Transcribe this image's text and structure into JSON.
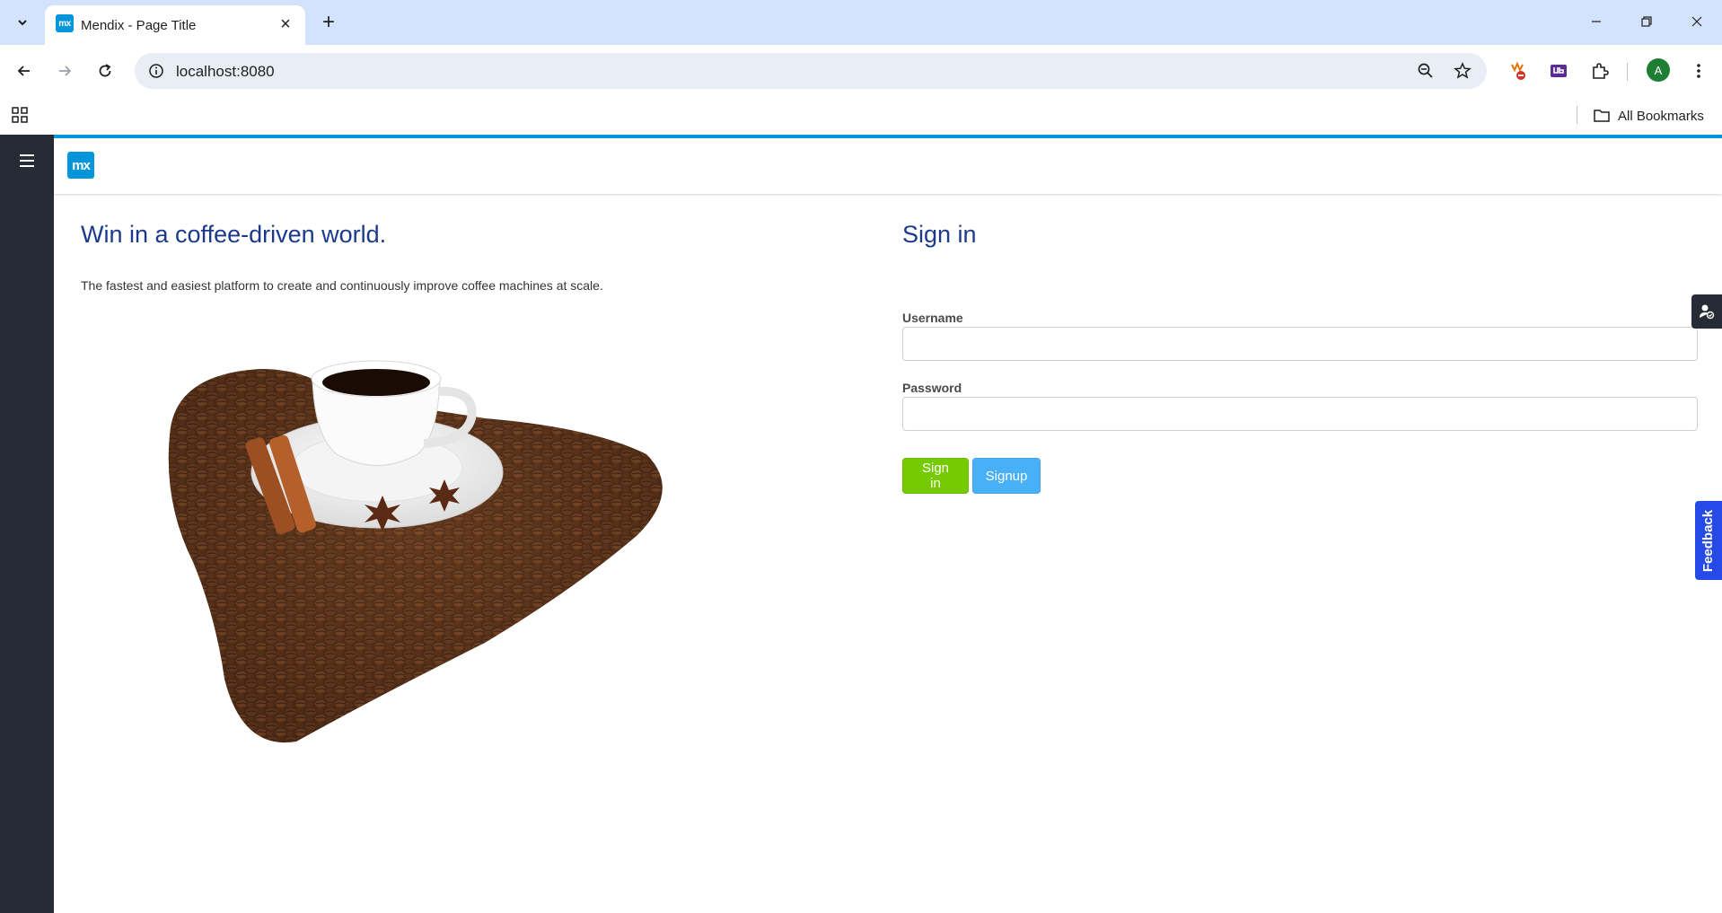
{
  "browser": {
    "tab_title": "Mendix - Page Title",
    "favicon_text": "mx",
    "url": "localhost:8080",
    "avatar_letter": "A",
    "bookmarks_label": "All Bookmarks"
  },
  "app": {
    "logo_text": "mx",
    "hero": {
      "title": "Win in a coffee-driven world.",
      "subtitle": "The fastest and easiest platform to create and continuously improve coffee machines at scale."
    },
    "login": {
      "title": "Sign in",
      "username_label": "Username",
      "username_value": "",
      "password_label": "Password",
      "password_value": "",
      "signin_button": "Sign in",
      "signup_button": "Signup"
    },
    "feedback_label": "Feedback"
  },
  "colors": {
    "accent": "#0595db",
    "heading": "#1b3a8c",
    "signin": "#76ca02",
    "signup": "#48b0f7",
    "sidebar": "#252c36",
    "feedback": "#264ae5"
  }
}
